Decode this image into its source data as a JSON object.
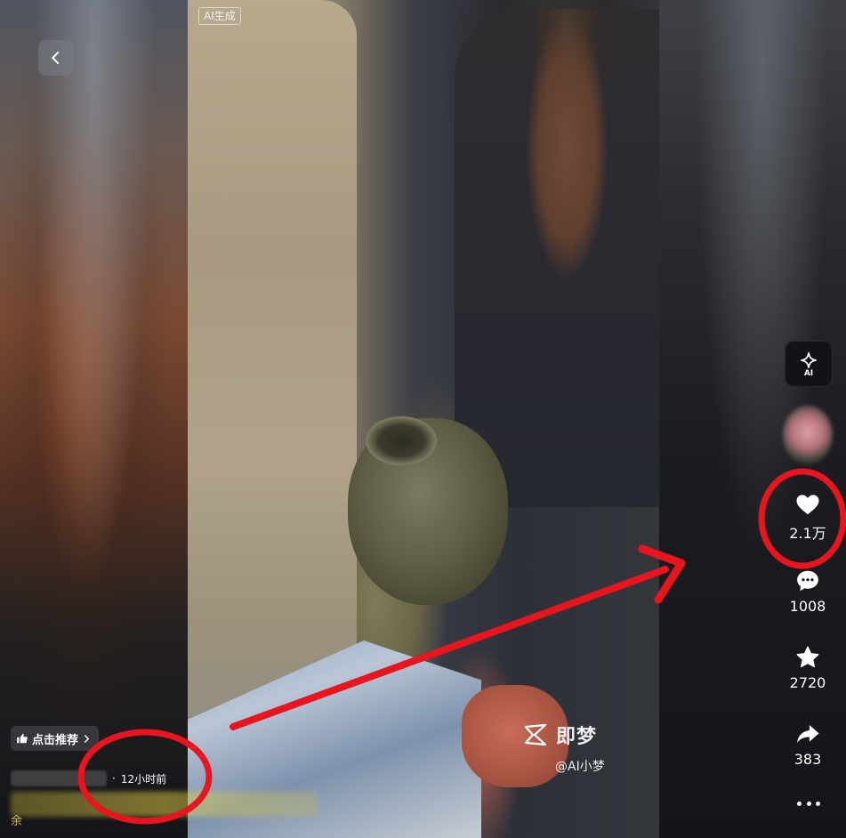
{
  "video": {
    "ai_tag": "AI生成",
    "watermark_brand": "即梦",
    "watermark_handle": "@AI小梦"
  },
  "left_panel": {
    "back_icon": "chevron-left-icon",
    "recommend_label": "点击推荐",
    "recommend_icon": "thumbs-up-icon",
    "time_ago": "12小时前",
    "caption_partial": "余"
  },
  "actions": {
    "ai_icon": "ai-sparkle-icon",
    "like": {
      "icon": "heart-icon",
      "count": "2.1万"
    },
    "comment": {
      "icon": "comment-icon",
      "count": "1008"
    },
    "favorite": {
      "icon": "star-icon",
      "count": "2720"
    },
    "share": {
      "icon": "share-icon",
      "count": "383"
    },
    "more_icon": "more-dots-icon"
  },
  "annotations": {
    "color": "#e8141e"
  }
}
